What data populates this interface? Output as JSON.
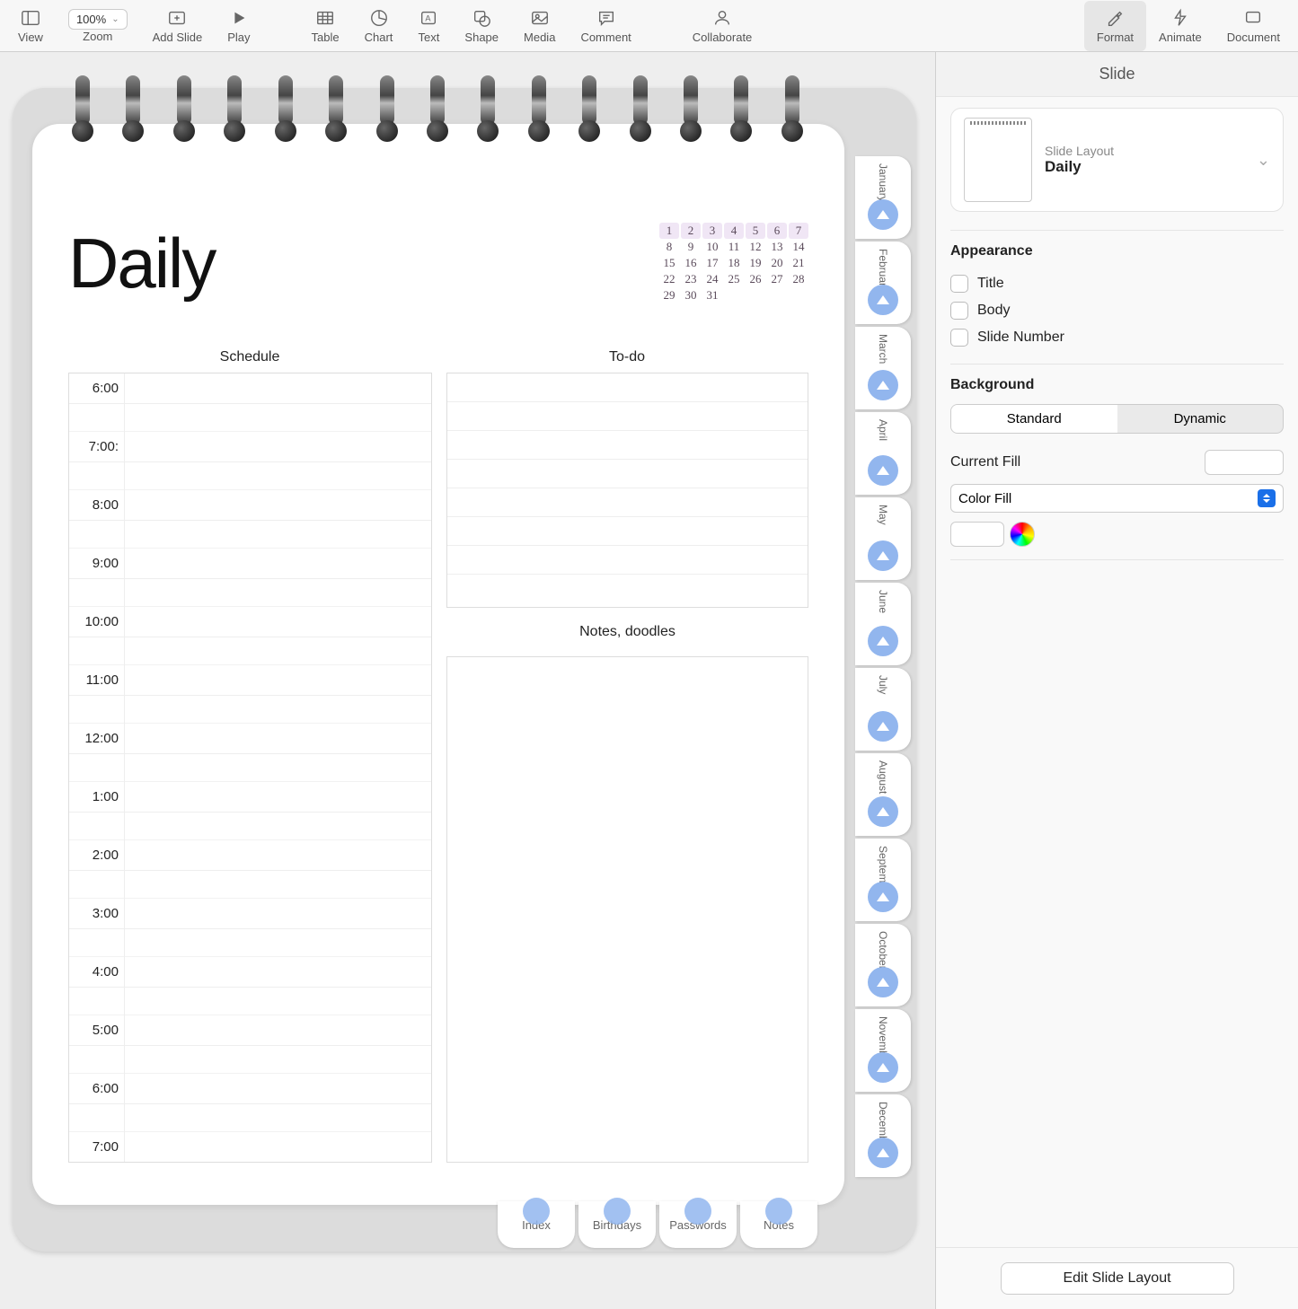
{
  "toolbar": {
    "view": "View",
    "zoom_value": "100%",
    "zoom": "Zoom",
    "add_slide": "Add Slide",
    "play": "Play",
    "table": "Table",
    "chart": "Chart",
    "text": "Text",
    "shape": "Shape",
    "media": "Media",
    "comment": "Comment",
    "collaborate": "Collaborate",
    "format": "Format",
    "animate": "Animate",
    "document": "Document"
  },
  "slide": {
    "title": "Daily",
    "schedule_header": "Schedule",
    "todo_header": "To-do",
    "notes_header": "Notes, doodles",
    "schedule_times": [
      "6:00",
      "7:00:",
      "8:00",
      "9:00",
      "10:00",
      "11:00",
      "12:00",
      "1:00",
      "2:00",
      "3:00",
      "4:00",
      "5:00",
      "6:00",
      "7:00"
    ],
    "calendar": {
      "rows": [
        [
          "1",
          "2",
          "3",
          "4",
          "5",
          "6",
          "7"
        ],
        [
          "8",
          "9",
          "10",
          "11",
          "12",
          "13",
          "14"
        ],
        [
          "15",
          "16",
          "17",
          "18",
          "19",
          "20",
          "21"
        ],
        [
          "22",
          "23",
          "24",
          "25",
          "26",
          "27",
          "28"
        ],
        [
          "29",
          "30",
          "31",
          "",
          "",
          "",
          ""
        ]
      ]
    },
    "month_tabs": [
      "January",
      "February",
      "March",
      "April",
      "May",
      "June",
      "July",
      "August",
      "September",
      "October",
      "November",
      "December"
    ],
    "bottom_tabs": [
      "Index",
      "Birthdays",
      "Passwords",
      "Notes"
    ]
  },
  "inspector": {
    "header": "Slide",
    "layout_label": "Slide Layout",
    "layout_name": "Daily",
    "appearance": "Appearance",
    "cb_title": "Title",
    "cb_body": "Body",
    "cb_slide_number": "Slide Number",
    "background": "Background",
    "seg_standard": "Standard",
    "seg_dynamic": "Dynamic",
    "current_fill": "Current Fill",
    "fill_type": "Color Fill",
    "edit_button": "Edit Slide Layout"
  }
}
